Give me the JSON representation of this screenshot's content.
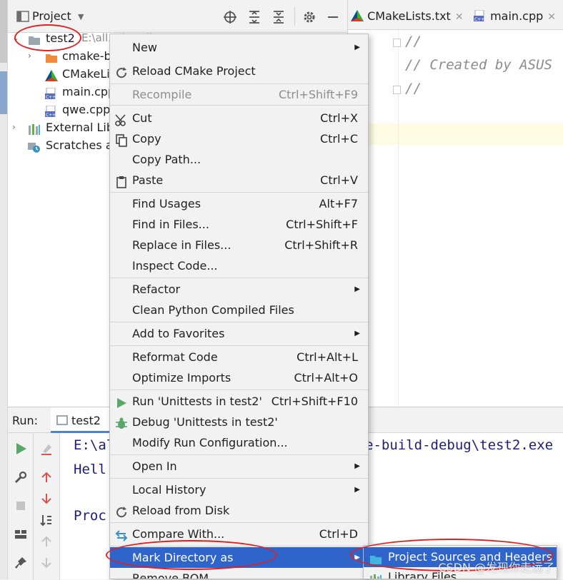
{
  "project_panel": {
    "title": "Project",
    "tree": [
      {
        "label": "test2",
        "hint": "E:\\all...d...\\Cli...\\V...\\t...2",
        "expanded": true,
        "icon": "folder-icon"
      },
      {
        "label": "cmake-b",
        "icon": "orange-folder-icon"
      },
      {
        "label": "CMakeLi",
        "icon": "cmake-icon"
      },
      {
        "label": "main.cpp",
        "icon": "cpp-file-icon"
      },
      {
        "label": "qwe.cpp",
        "icon": "cpp-file-icon"
      },
      {
        "label": "External Lib",
        "icon": "library-icon"
      },
      {
        "label": "Scratches ar",
        "icon": "scratches-icon"
      }
    ]
  },
  "editor": {
    "tabs": [
      {
        "label": "CMakeLists.txt",
        "icon": "cmake-icon"
      },
      {
        "label": "main.cpp",
        "icon": "cpp-file-icon"
      }
    ],
    "lines": [
      "//",
      "// Created by ASUS",
      "//"
    ]
  },
  "run_panel": {
    "label": "Run:",
    "tab": "test2",
    "console": [
      "E:\\al",
      "e-build-debug\\test2.exe",
      "Hell",
      "Proc"
    ]
  },
  "context_menu": {
    "items": [
      {
        "label": "New",
        "submenu": true
      },
      {
        "label": "Reload CMake Project",
        "icon": "reload-icon"
      },
      {
        "label": "Recompile",
        "shortcut": "Ctrl+Shift+F9",
        "disabled": true
      },
      {
        "label": "Cut",
        "shortcut": "Ctrl+X",
        "icon": "scissors-icon"
      },
      {
        "label": "Copy",
        "shortcut": "Ctrl+C",
        "icon": "copy-icon"
      },
      {
        "label": "Copy Path...",
        "shortcut": ""
      },
      {
        "label": "Paste",
        "shortcut": "Ctrl+V",
        "icon": "clipboard-icon"
      },
      {
        "label": "Find Usages",
        "shortcut": "Alt+F7"
      },
      {
        "label": "Find in Files...",
        "shortcut": "Ctrl+Shift+F"
      },
      {
        "label": "Replace in Files...",
        "shortcut": "Ctrl+Shift+R"
      },
      {
        "label": "Inspect Code..."
      },
      {
        "label": "Refactor",
        "submenu": true
      },
      {
        "label": "Clean Python Compiled Files"
      },
      {
        "label": "Add to Favorites",
        "submenu": true
      },
      {
        "label": "Reformat Code",
        "shortcut": "Ctrl+Alt+L"
      },
      {
        "label": "Optimize Imports",
        "shortcut": "Ctrl+Alt+O"
      },
      {
        "label": "Run 'Unittests in test2'",
        "shortcut": "Ctrl+Shift+F10",
        "icon": "run-icon"
      },
      {
        "label": "Debug 'Unittests in test2'",
        "icon": "debug-icon"
      },
      {
        "label": "Modify Run Configuration..."
      },
      {
        "label": "Open In",
        "submenu": true
      },
      {
        "label": "Local History",
        "submenu": true
      },
      {
        "label": "Reload from Disk",
        "icon": "reload-icon"
      },
      {
        "label": "Compare With...",
        "shortcut": "Ctrl+D",
        "icon": "compare-icon"
      },
      {
        "label": "Mark Directory as",
        "submenu": true,
        "selected": true
      },
      {
        "label": "Remove BOM"
      }
    ]
  },
  "submenu": {
    "items": [
      {
        "label": "Project Sources and Headers",
        "selected": true,
        "icon": "source-folder-icon"
      },
      {
        "label": "Library Files",
        "icon": "library-icon"
      }
    ]
  },
  "watermark": "CSDN @发现你走远了",
  "colors": {
    "selection": "#2f65ca",
    "annotation": "#e02020"
  }
}
